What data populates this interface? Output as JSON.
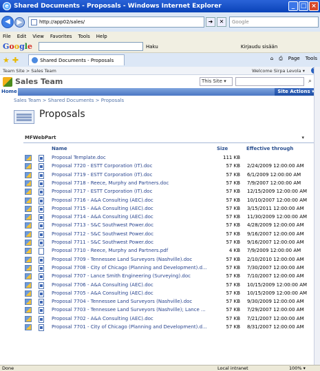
{
  "window": {
    "title": "Shared Documents - Proposals - Windows Internet Explorer",
    "minimize": "_",
    "maximize": "□",
    "close": "×"
  },
  "browser": {
    "back": "◀",
    "forward": "▶",
    "url": "http://app02/sales/",
    "search_placeholder": "Google",
    "menu": [
      "File",
      "Edit",
      "View",
      "Favorites",
      "Tools",
      "Help"
    ],
    "google_logo": "Google",
    "google_haku": "Haku",
    "google_signin": "Kirjaudu sisään",
    "tab_label": "Shared Documents - Proposals",
    "tools": {
      "page": "Page",
      "tools": "Tools"
    }
  },
  "sharepoint": {
    "top_breadcrumb": "Team Site > Sales Team",
    "welcome": "Welcome Sirpa Levola ▾",
    "site_title": "Sales Team",
    "scope": "This Site ▾",
    "home_tab": "Home",
    "site_actions": "Site Actions ▾",
    "breadcrumb": "Sales Team > Shared Documents > Proposals",
    "page_title": "Proposals"
  },
  "webpart": {
    "title": "MFWebPart",
    "menu": "▾",
    "columns": {
      "name": "Name",
      "size": "Size",
      "effective": "Effective through"
    },
    "rows": [
      {
        "name": "Proposal Template.doc",
        "size": "111 KB",
        "date": ""
      },
      {
        "name": "Proposal 7720 - ESTT Corporation (IT).doc",
        "size": "57 KB",
        "date": "2/24/2009 12:00:00 AM"
      },
      {
        "name": "Proposal 7719 - ESTT Corporation (IT).doc",
        "size": "57 KB",
        "date": "6/1/2009 12:00:00 AM"
      },
      {
        "name": "Proposal 7718 - Reece, Murphy and Partners.doc",
        "size": "57 KB",
        "date": "7/9/2007 12:00:00 AM"
      },
      {
        "name": "Proposal 7717 - ESTT Corporation (IT).doc",
        "size": "57 KB",
        "date": "12/15/2009 12:00:00 AM"
      },
      {
        "name": "Proposal 7716 - A&A Consulting (AEC).doc",
        "size": "57 KB",
        "date": "10/10/2007 12:00:00 AM"
      },
      {
        "name": "Proposal 7715 - A&A Consulting (AEC).doc",
        "size": "57 KB",
        "date": "3/15/2011 12:00:00 AM"
      },
      {
        "name": "Proposal 7714 - A&A Consulting (AEC).doc",
        "size": "57 KB",
        "date": "11/30/2009 12:00:00 AM"
      },
      {
        "name": "Proposal 7713 - S&C Southwest Power.doc",
        "size": "57 KB",
        "date": "4/28/2009 12:00:00 AM"
      },
      {
        "name": "Proposal 7712 - S&C Southwest Power.doc",
        "size": "57 KB",
        "date": "9/16/2007 12:00:00 AM"
      },
      {
        "name": "Proposal 7711 - S&C Southwest Power.doc",
        "size": "57 KB",
        "date": "9/16/2007 12:00:00 AM"
      },
      {
        "name": "Proposal 7710 - Reece, Murphy and Partners.pdf",
        "size": "4 KB",
        "date": "7/9/2009 12:00:00 AM"
      },
      {
        "name": "Proposal 7709 - Tennessee Land Surveyors (Nashville).doc",
        "size": "57 KB",
        "date": "2/10/2010 12:00:00 AM"
      },
      {
        "name": "Proposal 7708 - City of Chicago (Planning and Development).d...",
        "size": "57 KB",
        "date": "7/30/2007 12:00:00 AM"
      },
      {
        "name": "Proposal 7707 - Lance Smith Engineering (Surveying).doc",
        "size": "57 KB",
        "date": "7/10/2007 12:00:00 AM"
      },
      {
        "name": "Proposal 7706 - A&A Consulting (AEC).doc",
        "size": "57 KB",
        "date": "10/15/2009 12:00:00 AM"
      },
      {
        "name": "Proposal 7705 - A&A Consulting (AEC).doc",
        "size": "57 KB",
        "date": "10/15/2009 12:00:00 AM"
      },
      {
        "name": "Proposal 7704 - Tennessee Land Surveyors (Nashville).doc",
        "size": "57 KB",
        "date": "9/30/2009 12:00:00 AM"
      },
      {
        "name": "Proposal 7703 - Tennessee Land Surveyors (Nashville); Lance ...",
        "size": "57 KB",
        "date": "7/29/2007 12:00:00 AM"
      },
      {
        "name": "Proposal 7702 - A&A Consulting (AEC).doc",
        "size": "57 KB",
        "date": "7/21/2007 12:00:00 AM"
      },
      {
        "name": "Proposal 7701 - City of Chicago (Planning and Development).d...",
        "size": "57 KB",
        "date": "8/31/2007 12:00:00 AM"
      }
    ]
  },
  "status": {
    "done": "Done",
    "zone": "Local intranet",
    "zoom": "100% ▾"
  }
}
